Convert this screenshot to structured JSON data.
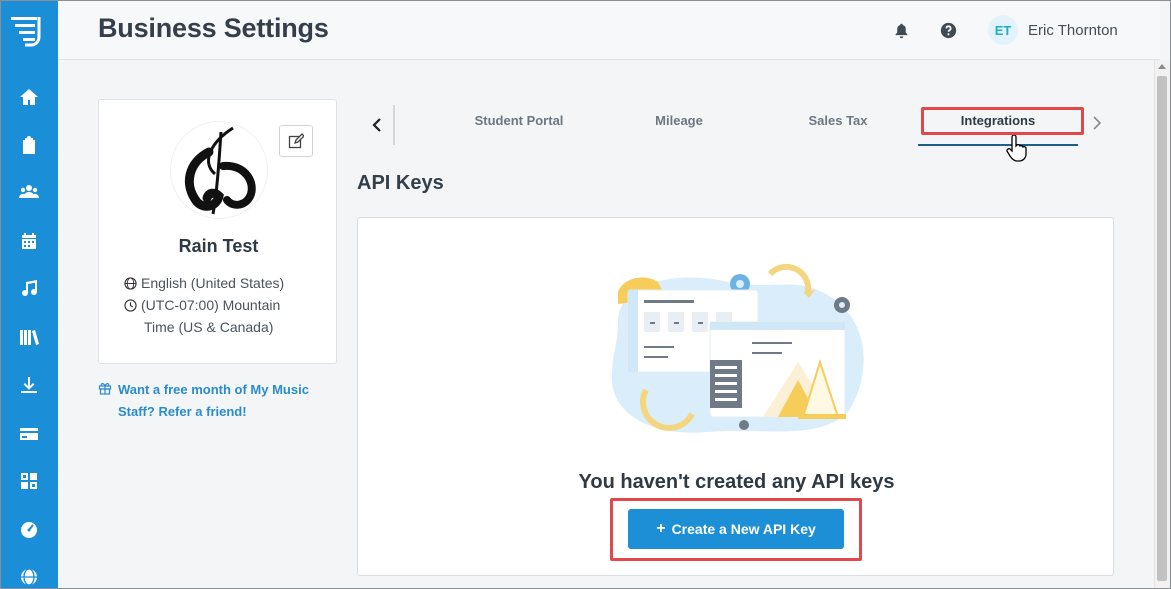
{
  "header": {
    "title": "Business Settings",
    "user": {
      "initials": "ET",
      "name": "Eric Thornton"
    }
  },
  "sidebar": {
    "items": [
      {
        "icon": "home-icon"
      },
      {
        "icon": "clipboard-icon"
      },
      {
        "icon": "users-icon"
      },
      {
        "icon": "calendar-icon"
      },
      {
        "icon": "music-note-icon"
      },
      {
        "icon": "library-icon"
      },
      {
        "icon": "download-icon"
      },
      {
        "icon": "credit-card-icon"
      },
      {
        "icon": "dashboard-grid-icon"
      },
      {
        "icon": "speedometer-icon"
      },
      {
        "icon": "globe-icon"
      }
    ]
  },
  "profile": {
    "business_name": "Rain Test",
    "language": "English (United States)",
    "timezone_line1": "(UTC-07:00) Mountain",
    "timezone_line2": "Time (US & Canada)"
  },
  "referral": {
    "line1": "Want a free month of My Music",
    "line2": "Staff? Refer a friend!"
  },
  "tabs": [
    {
      "label": "Student Portal",
      "active": false
    },
    {
      "label": "Mileage",
      "active": false
    },
    {
      "label": "Sales Tax",
      "active": false
    },
    {
      "label": "Integrations",
      "active": true
    }
  ],
  "section": {
    "title": "API Keys"
  },
  "api_card": {
    "empty_message": "You haven't created any API keys",
    "create_button": "Create a New API Key",
    "create_button_icon": "+"
  },
  "colors": {
    "sidebar": "#1a8fd8",
    "primary_button": "#1c8fd6",
    "highlight": "#e0484c",
    "link": "#2a8cc9"
  }
}
